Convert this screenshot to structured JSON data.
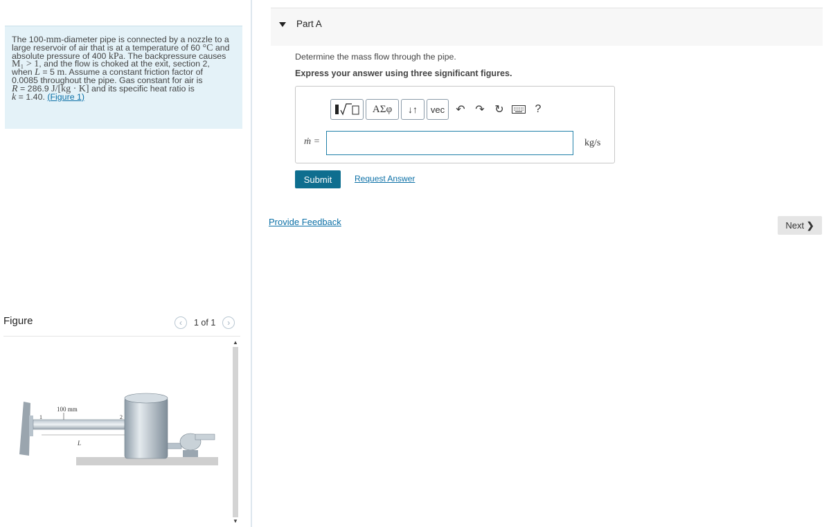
{
  "problem": {
    "line1": "The 100-",
    "unit_mm": "mm",
    "line1b": "-diameter pipe is connected by a nozzle to a",
    "line2": "large reservoir of air that is at a temperature of 60",
    "unit_degC": "°C",
    "line2b": " and",
    "line3": "absolute pressure of 400 ",
    "unit_kpa": "kPa",
    "line3b": ". The backpressure causes",
    "m1_cond": "M₁ > 1",
    "line4b": ", and the flow is choked at the exit, section 2,",
    "line5": "when ",
    "L_sym": "L",
    "line5b": " = 5 ",
    "unit_m": "m",
    "line5c": ". Assume a constant friction factor of",
    "line6": "0.0085 throughout the pipe. Gas constant for air is",
    "R_sym": "R",
    "line7b": " = 286.9 ",
    "R_unit": "J/[kg · K]",
    "line7c": " and its specific heat ratio is",
    "k_sym": "k",
    "line8b": " = 1.40. ",
    "figure_link": "(Figure 1)"
  },
  "figure": {
    "title": "Figure",
    "pager": "1 of 1",
    "dim_label": "100 mm",
    "section1": "1",
    "section2": "2",
    "length_label": "L"
  },
  "partA": {
    "title": "Part A",
    "question": "Determine the mass flow through the pipe.",
    "instruction": "Express your answer using three significant figures.",
    "toolbar": {
      "greek_label": "ΑΣφ",
      "sort_label": "↓↑",
      "vec_label": "vec",
      "help_label": "?"
    },
    "variable_label": "ṁ =",
    "input_value": "",
    "unit": "kg/s",
    "submit_label": "Submit",
    "request_label": "Request Answer"
  },
  "footer": {
    "feedback_label": "Provide Feedback",
    "next_label": "Next",
    "next_icon": "❯"
  }
}
